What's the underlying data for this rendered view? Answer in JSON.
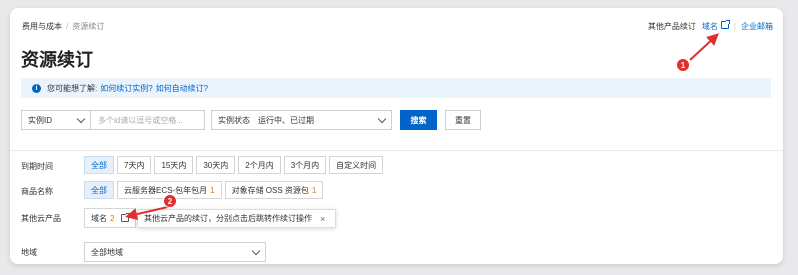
{
  "breadcrumb": {
    "items": [
      "费用与成本",
      "资源续订"
    ],
    "separator": "/"
  },
  "toplinks": {
    "other_label": "其他产品续订",
    "domain_label": "域名",
    "mail_label": "企业邮箱"
  },
  "page": {
    "title": "资源续订"
  },
  "notice": {
    "prefix": "您可能想了解:",
    "link1": "如何续订实例?",
    "link2": "如何自动续订?",
    "icon": "info-icon"
  },
  "filters": {
    "instance_select": "实例ID",
    "instance_placeholder": "多个id请以逗号或空格...",
    "status_label": "实例状态",
    "status_value": "运行中、已过期",
    "search_button": "搜索",
    "reset_button": "重置"
  },
  "expire": {
    "label": "到期时间",
    "options": [
      "全部",
      "7天内",
      "15天内",
      "30天内",
      "2个月内",
      "3个月内",
      "自定义时间"
    ]
  },
  "product": {
    "label": "商品名称",
    "options": [
      {
        "name": "全部",
        "count": ""
      },
      {
        "name": "云服务器ECS-包年包月",
        "count": "1"
      },
      {
        "name": "对象存储 OSS 资源包",
        "count": "1"
      }
    ]
  },
  "other": {
    "label": "其他云产品",
    "chip_name": "域名",
    "chip_count": "2",
    "tooltip": "其他云产品的续订，分别点击后跳转作续订操作",
    "tooltip_close": "×"
  },
  "region": {
    "label": "地域",
    "value": "全部地域"
  },
  "annotations": {
    "marker1": "1",
    "marker2": "2",
    "color": "#e0302c"
  },
  "colors": {
    "accent": "#0064c8",
    "count": "#e0781e",
    "notice_bg": "#ebf3fc"
  }
}
